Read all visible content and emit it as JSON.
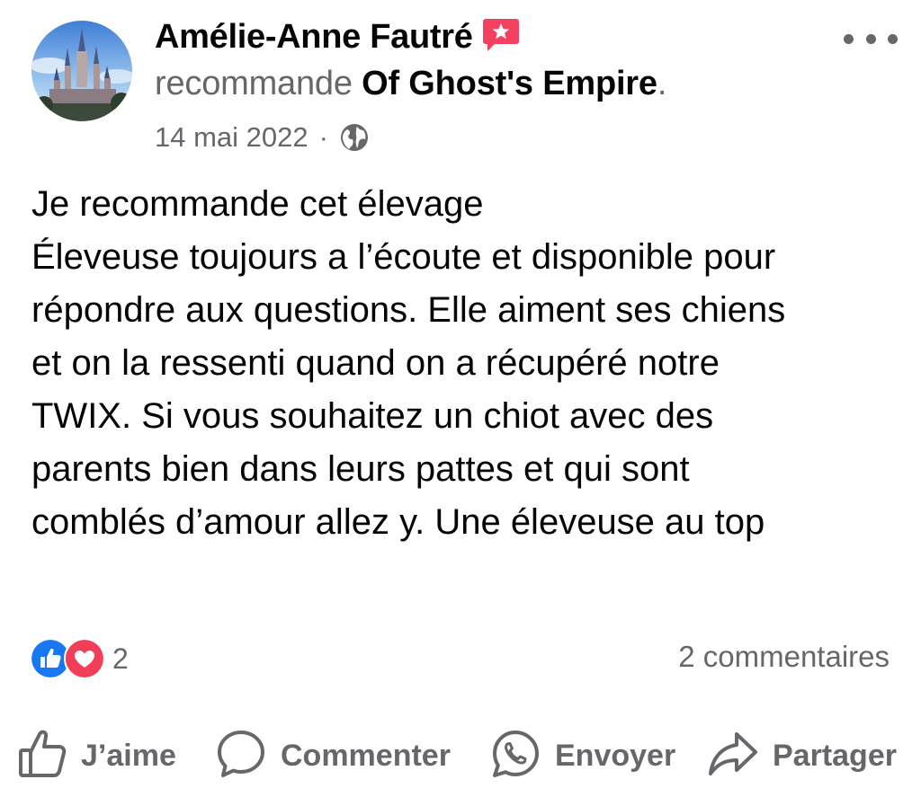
{
  "post": {
    "author_name": "Amélie-Anne Fautré",
    "verb": "recommande",
    "page_name": "Of Ghost's Empire",
    "period": ".",
    "date": "14 mai 2022",
    "separator": "·",
    "privacy_icon": "globe-icon",
    "badge_icon": "recommendation-star-icon",
    "body_lines": [
      "Je recommande cet élevage",
      "Éleveuse toujours a l’écoute et disponible pour",
      "répondre aux questions. Elle aiment ses chiens",
      "et on la ressenti quand on a récupéré notre",
      "TWIX. Si vous souhaitez un chiot avec des",
      "parents bien dans leurs pattes et qui sont",
      "comblés d’amour allez y. Une éleveuse au top"
    ]
  },
  "engagement": {
    "reaction_icons": [
      "like-icon",
      "love-icon"
    ],
    "reaction_count": "2",
    "comments_label": "2 commentaires"
  },
  "actions": {
    "like_label": "J’aime",
    "comment_label": "Commenter",
    "send_label": "Envoyer",
    "share_label": "Partager"
  },
  "colors": {
    "text_primary": "#050505",
    "text_secondary": "#65676b",
    "like_blue": "#1877f2",
    "love_red": "#f33e58",
    "badge_red": "#f3425f"
  }
}
